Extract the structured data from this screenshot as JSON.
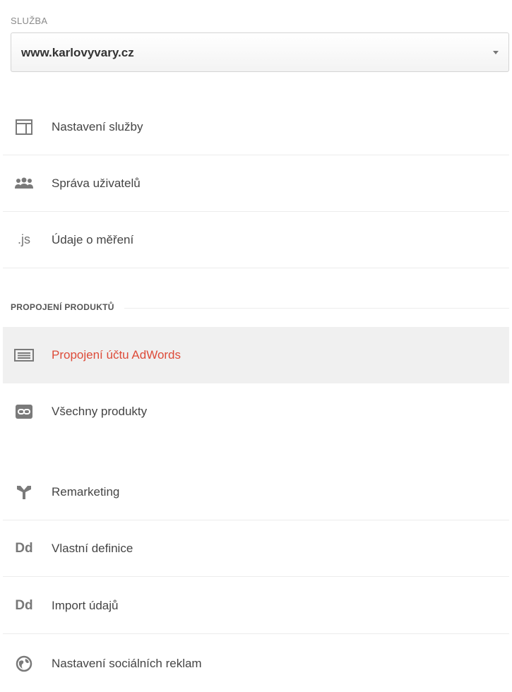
{
  "service": {
    "label": "SLUŽBA",
    "selected": "www.karlovyvary.cz"
  },
  "nav_top": [
    {
      "label": "Nastavení služby",
      "icon": "layout-panel-icon"
    },
    {
      "label": "Správa uživatelů",
      "icon": "users-group-icon"
    },
    {
      "label": "Údaje o měření",
      "icon": ".js",
      "icon_name": "js-code-icon"
    }
  ],
  "section": {
    "title": "PROPOJENÍ PRODUKTŮ"
  },
  "nav_products": [
    {
      "label": "Propojení účtu AdWords",
      "icon": "adwords-list-icon",
      "active": true
    },
    {
      "label": "Všechny produkty",
      "icon": "link-icon"
    }
  ],
  "nav_bottom": [
    {
      "label": "Remarketing",
      "icon": "remarketing-fork-icon"
    },
    {
      "label": "Vlastní definice",
      "icon": "Dd",
      "icon_name": "custom-definitions-icon"
    },
    {
      "label": "Import údajů",
      "icon": "Dd",
      "icon_name": "data-import-icon"
    },
    {
      "label": "Nastavení sociálních reklam",
      "icon": "globe-icon"
    }
  ],
  "colors": {
    "active_text": "#dd4b39",
    "active_bg": "#f0f0f0",
    "icon_gray": "#777777"
  }
}
